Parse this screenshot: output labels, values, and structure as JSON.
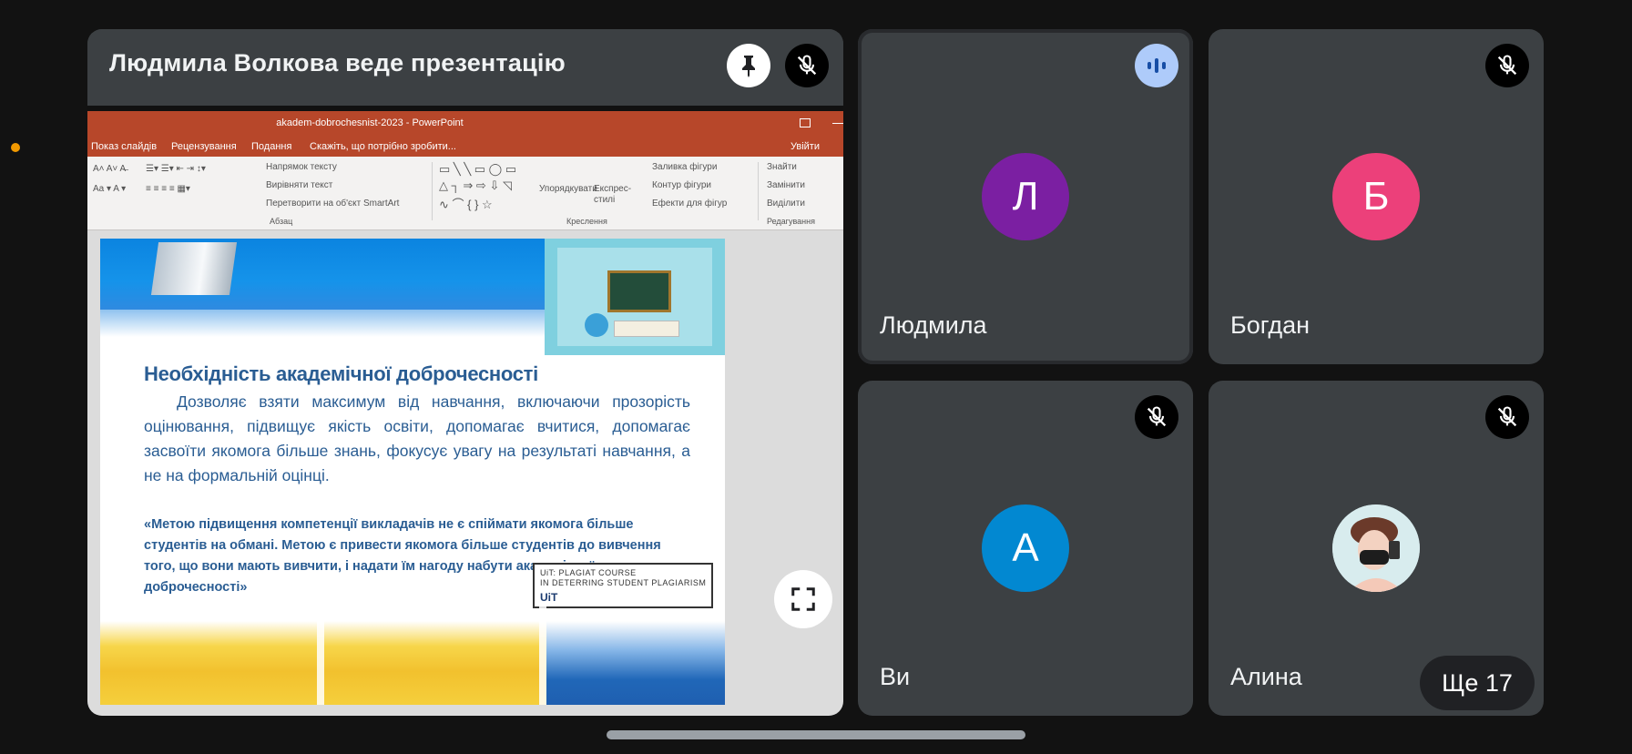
{
  "colors": {
    "background": "#121212",
    "tile": "#3c4043",
    "avatar_l": "#7b1fa2",
    "avatar_b": "#ec407a",
    "avatar_a": "#0288d1",
    "speaking": "#aecbfa",
    "status_dot": "#f29900"
  },
  "presenter": {
    "title": "Людмила Волкова веде презентацію",
    "pin_icon": "pin-icon",
    "mute_icon": "mic-off-icon",
    "fullscreen_icon": "fullscreen-icon"
  },
  "powerpoint": {
    "window_title": "akadem-dobrochesnist-2023 - PowerPoint",
    "menu": [
      "Показ слайдів",
      "Рецензування",
      "Подання",
      "Скажіть, що потрібно зробити...",
      "Увійти"
    ],
    "ribbon": {
      "text_direction": "Напрямок тексту",
      "align_text": "Вирівняти текст",
      "convert_smartart": "Перетворити на об'єкт SmartArt",
      "arrange": "Упорядкувати",
      "quick_styles": "Експрес-стилі",
      "shape_fill": "Заливка фігури",
      "shape_outline": "Контур фігури",
      "shape_effects": "Ефекти для фігур",
      "find": "Знайти",
      "replace": "Замінити",
      "select": "Виділити",
      "group_paragraph": "Абзац",
      "group_drawing": "Креслення",
      "group_editing": "Редагування"
    }
  },
  "slide": {
    "heading": "Необхідність академічної доброчесності",
    "body": "Дозволяє взяти максимум від навчання, включаючи прозорість оцінювання, підвищує якість освіти, допомагає вчитися, допомагає засвоїти якомога більше знань, фокусує увагу на результаті навчання, а не на формальній оцінці.",
    "quote": "«Метою підвищення компетенції викладачів не є спіймати якомога більше студентів на обмані. Метою є привести якомога більше студентів до вивчення того, що вони мають вивчити, і надати їм нагоду набути академічної доброчесності»",
    "course_line1": "UiT: PLAGIAT COURSE",
    "course_line2": "IN DETERRING STUDENT PLAGIARISM",
    "logo": "UiT"
  },
  "participants": [
    {
      "name": "Людмила",
      "initial": "Л",
      "state": "speaking"
    },
    {
      "name": "Богдан",
      "initial": "Б",
      "state": "muted"
    },
    {
      "name": "Ви",
      "initial": "А",
      "state": "muted"
    },
    {
      "name": "Алина",
      "initial": "",
      "state": "muted"
    }
  ],
  "more_participants": "Ще 17"
}
